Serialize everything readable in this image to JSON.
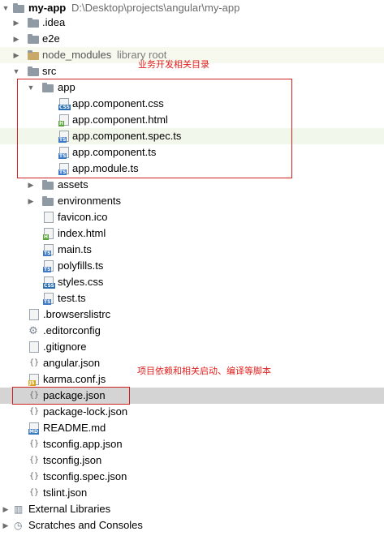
{
  "tree": {
    "root": {
      "name": "my-app",
      "path": "D:\\Desktop\\projects\\angular\\my-app"
    },
    "items": [
      {
        "label": ".idea"
      },
      {
        "label": "e2e"
      },
      {
        "label": "node_modules",
        "suffix": "library root"
      },
      {
        "label": "src"
      },
      {
        "label": "app"
      },
      {
        "label": "app.component.css",
        "badge": "CSS"
      },
      {
        "label": "app.component.html",
        "badge": "H"
      },
      {
        "label": "app.component.spec.ts",
        "badge": "TS"
      },
      {
        "label": "app.component.ts",
        "badge": "TS"
      },
      {
        "label": "app.module.ts",
        "badge": "TS"
      },
      {
        "label": "assets"
      },
      {
        "label": "environments"
      },
      {
        "label": "favicon.ico"
      },
      {
        "label": "index.html",
        "badge": "H"
      },
      {
        "label": "main.ts",
        "badge": "TS"
      },
      {
        "label": "polyfills.ts",
        "badge": "TS"
      },
      {
        "label": "styles.css",
        "badge": "CSS"
      },
      {
        "label": "test.ts",
        "badge": "TS"
      },
      {
        "label": ".browserslistrc"
      },
      {
        "label": ".editorconfig"
      },
      {
        "label": ".gitignore"
      },
      {
        "label": "angular.json"
      },
      {
        "label": "karma.conf.js",
        "badge": "JS"
      },
      {
        "label": "package.json"
      },
      {
        "label": "package-lock.json"
      },
      {
        "label": "README.md",
        "badge": "MD"
      },
      {
        "label": "tsconfig.app.json"
      },
      {
        "label": "tsconfig.json"
      },
      {
        "label": "tsconfig.spec.json"
      },
      {
        "label": "tslint.json"
      },
      {
        "label": "External Libraries"
      },
      {
        "label": "Scratches and Consoles"
      }
    ]
  },
  "annotations": {
    "app_dir_note": "业务开发相关目录",
    "package_json_note": "项目依赖和相关启动、编译等脚本"
  },
  "colors": {
    "annotation_red": "#d21f1f",
    "selection_gray": "#d4d4d4",
    "spec_highlight": "#f2f7ec"
  }
}
